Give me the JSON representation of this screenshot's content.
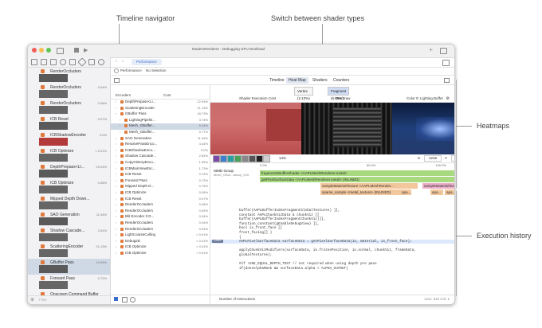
{
  "annotations": {
    "timeline_navigator": "Timeline navigator",
    "switch_shader": "Switch between shader types",
    "heatmaps": "Heatmaps",
    "execution_history": "Execution history"
  },
  "window": {
    "title": "ModernRenderer - Debugging GPU Workload",
    "tab": "Performance",
    "breadcrumb_a": "Performance",
    "breadcrumb_b": "No Selection"
  },
  "sidebar": {
    "items": [
      {
        "label": "RenderOccluders",
        "pct": "",
        "kind": "thumb"
      },
      {
        "label": "RenderOccluders",
        "pct": "0.04%",
        "kind": "thumb"
      },
      {
        "label": "RenderOccluders",
        "pct": "0.08%",
        "kind": "thumb"
      },
      {
        "label": "ICB Reset",
        "pct": "0.07%",
        "kind": "thumb"
      },
      {
        "label": "ICBShadowEncoder",
        "pct": "3.0%",
        "kind": "thumb"
      },
      {
        "label": "ICB Optimize",
        "pct": "< 0.01%",
        "kind": "thumb"
      },
      {
        "label": "DepthPrepass<LI...",
        "pct": "23.04%",
        "kind": "thumb"
      },
      {
        "label": "ICB Optimize",
        "pct": "0.08%",
        "kind": "thumb"
      },
      {
        "label": "Mipped Depth Down...",
        "pct": "",
        "kind": "thumb"
      },
      {
        "label": "SAO Generation",
        "pct": "11.94%",
        "kind": "thumb"
      },
      {
        "label": "Shadow Cascade...",
        "pct": "2.64%",
        "kind": "thumb"
      },
      {
        "label": "ScatteringEncoder",
        "pct": "21.13%",
        "kind": "thumb"
      },
      {
        "label": "GBuffer Pass",
        "pct": "10.65%",
        "kind": "thumb"
      },
      {
        "label": "Forward Pass",
        "pct": "0.72%",
        "kind": "thumb"
      },
      {
        "label": "Onscreen Command Buffer",
        "pct": "",
        "kind": "thumb"
      }
    ],
    "section_label": "No Previews",
    "filter_placeholder": "Filter"
  },
  "tabs": {
    "timeline": "Timeline",
    "heatmap": "Heat Map",
    "shaders": "Shaders",
    "counters": "Counters"
  },
  "list": {
    "col_encoders": "Encoders",
    "col_cost": "Cost",
    "items": [
      {
        "label": "DepthPrepass<Li...",
        "cost": "22.94%",
        "indent": 0
      },
      {
        "label": "ScatteringEncoder",
        "cost": "21.13%",
        "indent": 0
      },
      {
        "label": "GBuffer Pass",
        "cost": "18.73%",
        "indent": 0
      },
      {
        "label": "LightingPipelin...",
        "cost": "3.74%",
        "indent": 1
      },
      {
        "label": "Mesh_GBuffer...",
        "cost": "8.18%",
        "indent": 1
      },
      {
        "label": "Mesh_GBuffer...",
        "cost": "0.77%",
        "indent": 1
      },
      {
        "label": "SAO Generation",
        "cost": "11.94%",
        "indent": 0
      },
      {
        "label": "ResolvePassEnco...",
        "cost": "4.44%",
        "indent": 0
      },
      {
        "label": "ICBShadowEnco...",
        "cost": "3.0%",
        "indent": 0
      },
      {
        "label": "Shadow Cascade...",
        "cost": "2.64%",
        "indent": 0
      },
      {
        "label": "CopyHistoryEnco...",
        "cost": "1.95%",
        "indent": 0
      },
      {
        "label": "ICBMainViewEnc...",
        "cost": "1.73%",
        "indent": 0
      },
      {
        "label": "ICB Reset",
        "cost": "0.19%",
        "indent": 0
      },
      {
        "label": "Forward Pass",
        "cost": "0.72%",
        "indent": 0
      },
      {
        "label": "Mipped Depth D...",
        "cost": "0.75%",
        "indent": 0
      },
      {
        "label": "ICB Optimize",
        "cost": "0.08%",
        "indent": 0
      },
      {
        "label": "ICB Reset",
        "cost": "0.07%",
        "indent": 0
      },
      {
        "label": "RenderOccluders",
        "cost": "0.08%",
        "indent": 0
      },
      {
        "label": "RenderOccluders",
        "cost": "0.05%",
        "indent": 0
      },
      {
        "label": "Blit Encoder 3 D...",
        "cost": "0.04%",
        "indent": 0
      },
      {
        "label": "RenderOccluders",
        "cost": "0.04%",
        "indent": 0
      },
      {
        "label": "RenderOccluders",
        "cost": "0.04%",
        "indent": 0
      },
      {
        "label": "LightCoarseCulling",
        "cost": "< 0.01%",
        "indent": 0
      },
      {
        "label": "Debug2D",
        "cost": "< 0.01%",
        "indent": 0
      },
      {
        "label": "ICB Optimize",
        "cost": "< 0.01%",
        "indent": 0
      },
      {
        "label": "ICB Optimize",
        "cost": "< 0.01%",
        "indent": 0
      }
    ]
  },
  "shader_switch": {
    "vertex": "Vertex (2.12%)",
    "fragment": "Fragment (6.08%)"
  },
  "heatmap": {
    "h1": "Shader Execution Cost",
    "h2": "Overdraw",
    "h3": "Color 0: Lighting Buffer",
    "zoom": "14%",
    "x_label": "X",
    "x_val": "1216",
    "y_label": "Y",
    "y_val": "680"
  },
  "timeline": {
    "axis": [
      "0.0%",
      "50.0%",
      "100.0%"
    ],
    "group_title": "SIMD Group",
    "group_sub": "Mesh_GBuf...assup_ICB",
    "bars": [
      {
        "label": "fragmentGBufferShader <AAPLMeshRenderer.metal>"
      },
      {
        "label": "getPixelSurfaceData <AAPLMeshRenderer.metal> (INLINED)"
      },
      {
        "label": "sampleMaterialTexture <AAPLMeshRender..."
      },
      {
        "label": "sampleMaterialTexture <AAPLMe..."
      },
      {
        "label": "sparse_sample <metal_texture> (INLINED)"
      },
      {
        "label": "apa..."
      },
      {
        "label": "apa..."
      },
      {
        "label": "apa..."
      },
      {
        "label": "spa..."
      }
    ]
  },
  "code": {
    "lines": [
      {
        "num": "",
        "text": "            buffer(AAPLBufferIndexFragmentGlobalTextures) ]],"
      },
      {
        "num": "",
        "text": "            constant AAPLChunkVizData & chunkViz             [["
      },
      {
        "num": "",
        "text": "            buffer(AAPLBufferIndexFragmentChunkViz)]],"
      },
      {
        "num": "",
        "text": "            function_constant(gEnableDebugView) ]],"
      },
      {
        "num": "",
        "text": "            bool is_front_face                               [["
      },
      {
        "num": "",
        "text": "            front_facing]] )"
      },
      {
        "num": "",
        "text": "{"
      },
      {
        "num": "",
        "text": "    AAPLPixelSurfaceData surfaceData = getPixelSurfaceData(in, material, is_front_face);"
      },
      {
        "num": "",
        "text": ""
      },
      {
        "num": "",
        "text": "    applyChunkVizModifiers(surfaceData, in.frozenPosition, in.normal, chunkViz, frameData,"
      },
      {
        "num": "",
        "text": "    globalTextures);"
      },
      {
        "num": "",
        "text": ""
      },
      {
        "num": "",
        "text": "#if !USE_EQUAL_DEPTH_TEST // not required when using depth pre pass"
      },
      {
        "num": "",
        "text": "    if(doesAlphaMask && surfaceData.alpha < ALPHA_CUTOUT)"
      }
    ],
    "badge": "1464"
  },
  "bottom": {
    "instructions": "Number of Instructions",
    "pos": "Line: 312 Col: 1"
  }
}
